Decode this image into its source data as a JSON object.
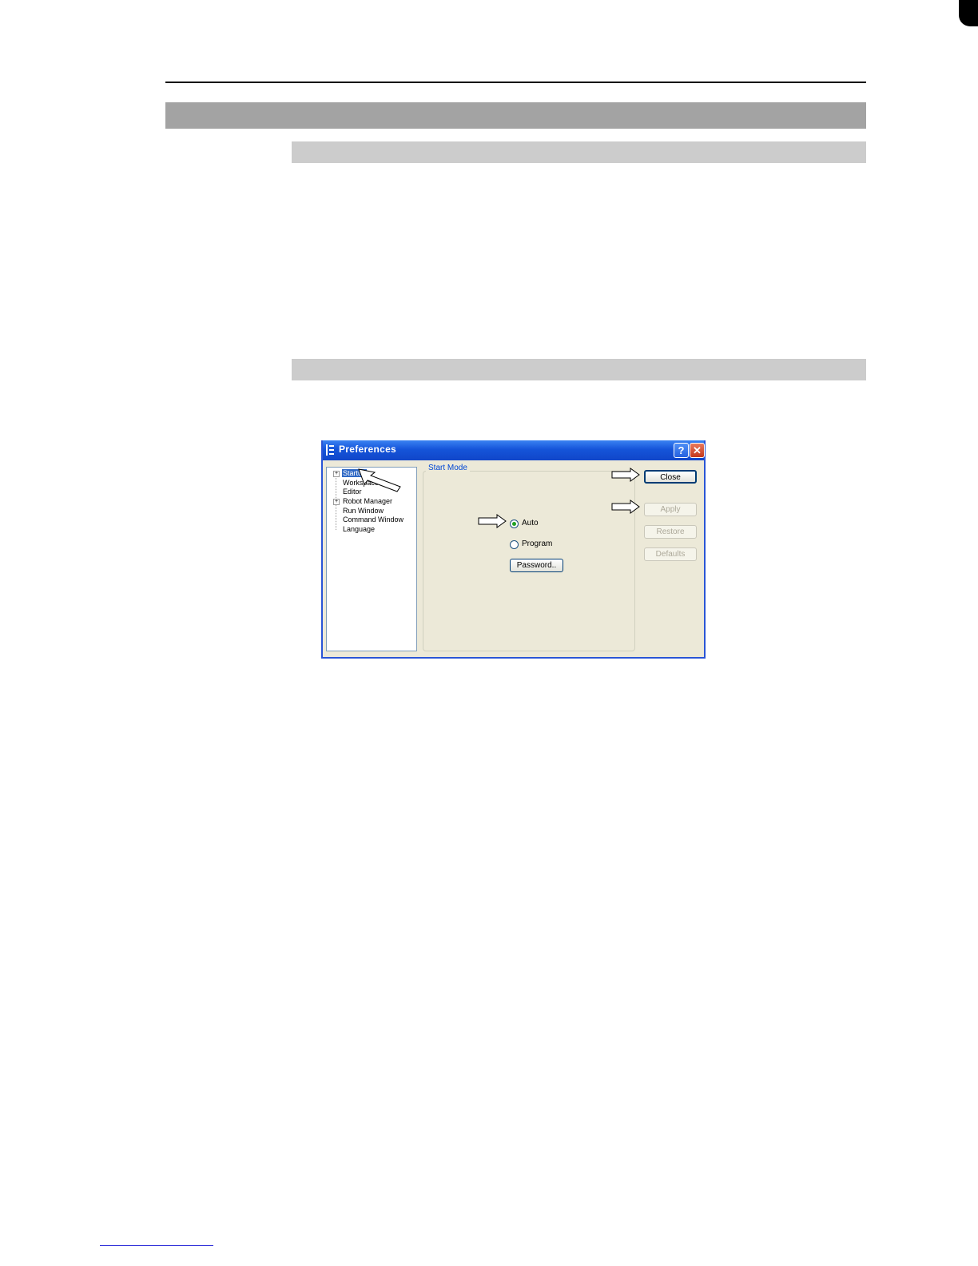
{
  "dialog": {
    "title": "Preferences",
    "help_button": "?",
    "close_button": "✕",
    "tree": {
      "items": [
        "Startup",
        "Workspace",
        "Editor",
        "Robot Manager",
        "Run Window",
        "Command Window",
        "Language"
      ],
      "selected": "Startup"
    },
    "group_label": "Start Mode",
    "radio_auto": "Auto",
    "radio_program": "Program",
    "radio_selected": "Auto",
    "password_button": "Password..",
    "buttons": {
      "close": "Close",
      "apply": "Apply",
      "restore": "Restore",
      "defaults": "Defaults"
    }
  },
  "colors": {
    "titlebar": "#1554d9",
    "dialog_bg": "#ece9d8",
    "chapter_bar": "#a3a3a3",
    "section_bar": "#cccccc"
  },
  "icons": [
    "app-icon",
    "help-icon",
    "close-icon",
    "callout-arrow-icon"
  ]
}
